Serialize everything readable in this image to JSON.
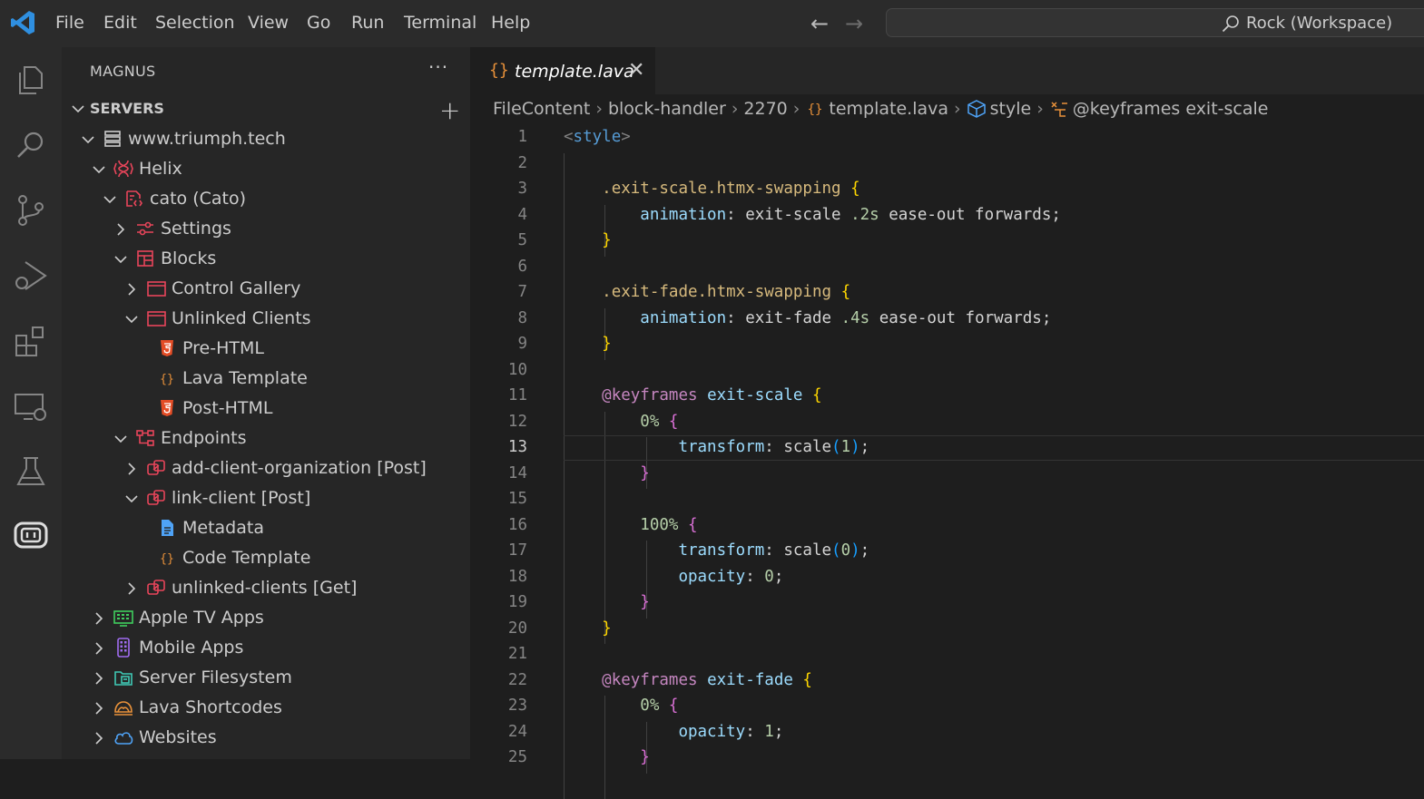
{
  "titlebar": {
    "menu": [
      "File",
      "Edit",
      "Selection",
      "View",
      "Go",
      "Run",
      "Terminal",
      "Help"
    ],
    "command_center_label": "Rock (Workspace)"
  },
  "activity_bar": {
    "icons": [
      "explorer-icon",
      "search-icon",
      "source-control-icon",
      "run-debug-icon",
      "extensions-icon",
      "remote-explorer-icon",
      "testing-icon",
      "rock-icon"
    ]
  },
  "sidebar": {
    "title": "MAGNUS",
    "section_title": "SERVERS",
    "tree": [
      {
        "label": "www.triumph.tech",
        "indent": 0,
        "chevron": "down",
        "icon": "server-icon",
        "color": "#cccccc"
      },
      {
        "label": "Helix",
        "indent": 1,
        "chevron": "down",
        "icon": "helix-icon",
        "color": "#e8455a"
      },
      {
        "label": "cato (Cato)",
        "indent": 2,
        "chevron": "down",
        "icon": "plugin-icon",
        "color": "#e8455a"
      },
      {
        "label": "Settings",
        "indent": 3,
        "chevron": "right",
        "icon": "settings-sliders-icon",
        "color": "#e8455a"
      },
      {
        "label": "Blocks",
        "indent": 3,
        "chevron": "down",
        "icon": "blocks-layout-icon",
        "color": "#e8455a"
      },
      {
        "label": "Control Gallery",
        "indent": 4,
        "chevron": "right",
        "icon": "block-window-icon",
        "color": "#e8455a"
      },
      {
        "label": "Unlinked Clients",
        "indent": 4,
        "chevron": "down",
        "icon": "block-window-icon",
        "color": "#e8455a"
      },
      {
        "label": "Pre-HTML",
        "indent": 5,
        "chevron": "none",
        "icon": "html5-icon",
        "color": "#e44d26"
      },
      {
        "label": "Lava Template",
        "indent": 5,
        "chevron": "none",
        "icon": "braces-icon",
        "color": "#e8913a"
      },
      {
        "label": "Post-HTML",
        "indent": 5,
        "chevron": "none",
        "icon": "html5-icon",
        "color": "#e44d26"
      },
      {
        "label": "Endpoints",
        "indent": 3,
        "chevron": "down",
        "icon": "endpoints-tree-icon",
        "color": "#e8455a"
      },
      {
        "label": "add-client-organization [Post]",
        "indent": 4,
        "chevron": "right",
        "icon": "endpoint-icon",
        "color": "#e8455a"
      },
      {
        "label": "link-client [Post]",
        "indent": 4,
        "chevron": "down",
        "icon": "endpoint-icon",
        "color": "#e8455a"
      },
      {
        "label": "Metadata",
        "indent": 5,
        "chevron": "none",
        "icon": "file-icon",
        "color": "#4fa3f7"
      },
      {
        "label": "Code Template",
        "indent": 5,
        "chevron": "none",
        "icon": "braces-icon",
        "color": "#e8913a"
      },
      {
        "label": "unlinked-clients [Get]",
        "indent": 4,
        "chevron": "right",
        "icon": "endpoint-icon",
        "color": "#e8455a"
      },
      {
        "label": "Apple TV Apps",
        "indent": 1,
        "chevron": "right",
        "icon": "tv-icon",
        "color": "#3fcf5e"
      },
      {
        "label": "Mobile Apps",
        "indent": 1,
        "chevron": "right",
        "icon": "mobile-icon",
        "color": "#a06cf0"
      },
      {
        "label": "Server Filesystem",
        "indent": 1,
        "chevron": "right",
        "icon": "filesystem-icon",
        "color": "#3fc9b5"
      },
      {
        "label": "Lava Shortcodes",
        "indent": 1,
        "chevron": "right",
        "icon": "lava-icon",
        "color": "#e8913a"
      },
      {
        "label": "Websites",
        "indent": 1,
        "chevron": "right",
        "icon": "cloud-icon",
        "color": "#4fa3f7"
      }
    ]
  },
  "editor": {
    "tab_label": "template.lava",
    "tab_icon_glyph": "{}",
    "breadcrumb": [
      "FileContent",
      "block-handler",
      "2270",
      "template.lava",
      "style",
      "@keyframes exit-scale"
    ],
    "active_line": 13,
    "lines": [
      [
        [
          "c-punct",
          "<"
        ],
        [
          "c-tag",
          "style"
        ],
        [
          "c-punct",
          ">"
        ]
      ],
      [],
      [
        [
          "c-plain",
          "    "
        ],
        [
          "c-sel",
          ".exit-scale.htmx-swapping "
        ],
        [
          "c-brace",
          "{"
        ]
      ],
      [
        [
          "c-plain",
          "        "
        ],
        [
          "c-prop",
          "animation"
        ],
        [
          "c-plain",
          ": exit-scale "
        ],
        [
          "c-num",
          ".2s"
        ],
        [
          "c-plain",
          " ease-out forwards;"
        ]
      ],
      [
        [
          "c-plain",
          "    "
        ],
        [
          "c-brace",
          "}"
        ]
      ],
      [],
      [
        [
          "c-plain",
          "    "
        ],
        [
          "c-sel",
          ".exit-fade.htmx-swapping "
        ],
        [
          "c-brace",
          "{"
        ]
      ],
      [
        [
          "c-plain",
          "        "
        ],
        [
          "c-prop",
          "animation"
        ],
        [
          "c-plain",
          ": exit-fade "
        ],
        [
          "c-num",
          ".4s"
        ],
        [
          "c-plain",
          " ease-out forwards;"
        ]
      ],
      [
        [
          "c-plain",
          "    "
        ],
        [
          "c-brace",
          "}"
        ]
      ],
      [],
      [
        [
          "c-plain",
          "    "
        ],
        [
          "c-at",
          "@keyframes "
        ],
        [
          "c-kf",
          "exit-scale "
        ],
        [
          "c-brace",
          "{"
        ]
      ],
      [
        [
          "c-plain",
          "        "
        ],
        [
          "c-num",
          "0%"
        ],
        [
          "c-plain",
          " "
        ],
        [
          "c-brace2",
          "{"
        ]
      ],
      [
        [
          "c-plain",
          "            "
        ],
        [
          "c-prop",
          "transform"
        ],
        [
          "c-plain",
          ": scale"
        ],
        [
          "c-paren",
          "("
        ],
        [
          "c-num",
          "1"
        ],
        [
          "c-paren",
          ")"
        ],
        [
          "c-plain",
          ";"
        ]
      ],
      [
        [
          "c-plain",
          "        "
        ],
        [
          "c-brace2",
          "}"
        ]
      ],
      [],
      [
        [
          "c-plain",
          "        "
        ],
        [
          "c-num",
          "100%"
        ],
        [
          "c-plain",
          " "
        ],
        [
          "c-brace2",
          "{"
        ]
      ],
      [
        [
          "c-plain",
          "            "
        ],
        [
          "c-prop",
          "transform"
        ],
        [
          "c-plain",
          ": scale"
        ],
        [
          "c-paren",
          "("
        ],
        [
          "c-num",
          "0"
        ],
        [
          "c-paren",
          ")"
        ],
        [
          "c-plain",
          ";"
        ]
      ],
      [
        [
          "c-plain",
          "            "
        ],
        [
          "c-prop",
          "opacity"
        ],
        [
          "c-plain",
          ": "
        ],
        [
          "c-num",
          "0"
        ],
        [
          "c-plain",
          ";"
        ]
      ],
      [
        [
          "c-plain",
          "        "
        ],
        [
          "c-brace2",
          "}"
        ]
      ],
      [
        [
          "c-plain",
          "    "
        ],
        [
          "c-brace",
          "}"
        ]
      ],
      [],
      [
        [
          "c-plain",
          "    "
        ],
        [
          "c-at",
          "@keyframes "
        ],
        [
          "c-kf",
          "exit-fade "
        ],
        [
          "c-brace",
          "{"
        ]
      ],
      [
        [
          "c-plain",
          "        "
        ],
        [
          "c-num",
          "0%"
        ],
        [
          "c-plain",
          " "
        ],
        [
          "c-brace2",
          "{"
        ]
      ],
      [
        [
          "c-plain",
          "            "
        ],
        [
          "c-prop",
          "opacity"
        ],
        [
          "c-plain",
          ": "
        ],
        [
          "c-num",
          "1"
        ],
        [
          "c-plain",
          ";"
        ]
      ],
      [
        [
          "c-plain",
          "        "
        ],
        [
          "c-brace2",
          "}"
        ]
      ]
    ]
  }
}
